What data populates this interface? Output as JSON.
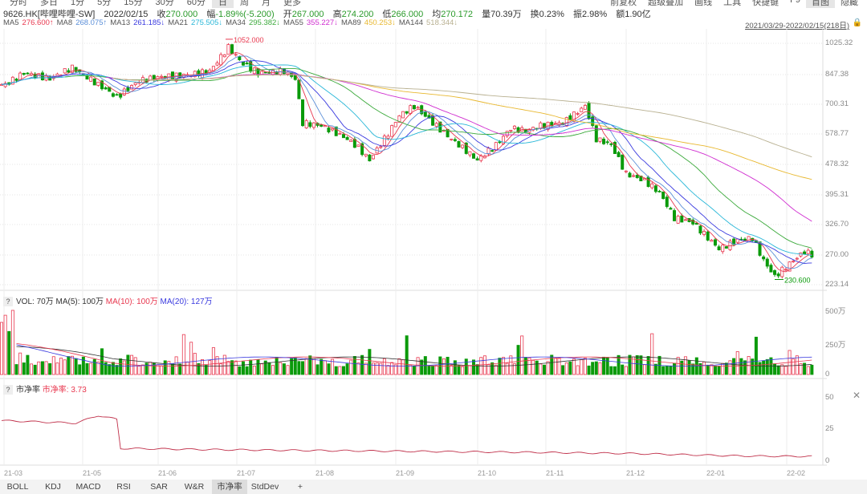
{
  "top_tabs": [
    "分时",
    "多日",
    "1分",
    "5分",
    "15分",
    "30分",
    "60分",
    "日",
    "周",
    "月",
    "更多"
  ],
  "top_tabs_selected": "日",
  "top_right": [
    "前复权",
    "超级叠加",
    "画线",
    "工具",
    "快捷键",
    "F9",
    "首图",
    "隐藏"
  ],
  "top_right_selected": "首图",
  "info": {
    "security": "9626.HK[哔哩哔哩-SW]",
    "date": "2022/02/15",
    "close_label": "收",
    "close": "270.000",
    "chg_label": "幅",
    "chg": "-1.89%(-5.200)",
    "open_label": "开",
    "open": "267.000",
    "high_label": "高",
    "high": "274.200",
    "low_label": "低",
    "low": "266.000",
    "avg_label": "均",
    "avg": "270.172",
    "vol_label": "量",
    "vol": "70.39万",
    "turn_label": "换",
    "turn": "0.23%",
    "amp_label": "振",
    "amp": "2.98%",
    "amt_label": "额",
    "amt": "1.90亿"
  },
  "ma_legend": [
    {
      "label": "MA5",
      "value": "276.600↑",
      "color": "#e8384f"
    },
    {
      "label": "MA8",
      "value": "268.075↑",
      "color": "#5b8fd8"
    },
    {
      "label": "MA13",
      "value": "261.185↓",
      "color": "#3a3adf"
    },
    {
      "label": "MA21",
      "value": "275.505↓",
      "color": "#29b7d8"
    },
    {
      "label": "MA34",
      "value": "295.382↓",
      "color": "#3caa3c"
    },
    {
      "label": "MA55",
      "value": "355.227↓",
      "color": "#d02ed0"
    },
    {
      "label": "MA89",
      "value": "450.253↓",
      "color": "#e8b830"
    },
    {
      "label": "MA144",
      "value": "518.344↓",
      "color": "#b8b090"
    }
  ],
  "date_range": "2021/03/29-2022/02/15(218日)",
  "price_axis": [
    "1025.32",
    "847.38",
    "700.31",
    "578.77",
    "478.32",
    "395.31",
    "326.70",
    "270.00",
    "223.14"
  ],
  "annotations": {
    "high": "1052.000",
    "low": "230.600"
  },
  "vol_header": {
    "q": "?",
    "vol": "VOL: 70万",
    "ma5": "MA(5): 100万",
    "ma10": "MA(10): 100万",
    "ma20": "MA(20): 127万"
  },
  "vol_axis": [
    "500万",
    "250万",
    "0"
  ],
  "pb_header": {
    "q": "?",
    "name": "市净率",
    "value": "市净率: 3.73"
  },
  "pb_axis": [
    "50",
    "25",
    "0"
  ],
  "bottom_tabs": [
    "BOLL",
    "KDJ",
    "MACD",
    "RSI",
    "SAR",
    "W&R",
    "市净率",
    "StdDev",
    "+"
  ],
  "bottom_selected": "市净率",
  "colors": {
    "up": "#e8384f",
    "down": "#0a9a0a"
  },
  "chart_data": {
    "type": "candlestick",
    "title": "9626.HK 哔哩哔哩-SW 日K",
    "x_range": [
      "2021/03/29",
      "2022/02/15"
    ],
    "x_tick_labels": [
      "21-03",
      "21-05",
      "21-06",
      "21-07",
      "21-08",
      "21-09",
      "21-10",
      "21-11",
      "21-12",
      "22-01",
      "22-02"
    ],
    "y_scale": "log",
    "ylim": [
      223.14,
      1025.32
    ],
    "approx_close_by_day_index": [
      [
        1,
        790
      ],
      [
        6,
        850
      ],
      [
        13,
        820
      ],
      [
        19,
        880
      ],
      [
        26,
        790
      ],
      [
        31,
        730
      ],
      [
        37,
        810
      ],
      [
        43,
        830
      ],
      [
        50,
        840
      ],
      [
        56,
        860
      ],
      [
        61,
        1000
      ],
      [
        65,
        900
      ],
      [
        69,
        850
      ],
      [
        76,
        860
      ],
      [
        79,
        820
      ],
      [
        81,
        620
      ],
      [
        86,
        610
      ],
      [
        93,
        560
      ],
      [
        96,
        530
      ],
      [
        99,
        490
      ],
      [
        104,
        580
      ],
      [
        107,
        650
      ],
      [
        111,
        690
      ],
      [
        116,
        620
      ],
      [
        121,
        560
      ],
      [
        125,
        520
      ],
      [
        128,
        490
      ],
      [
        133,
        540
      ],
      [
        137,
        600
      ],
      [
        141,
        590
      ],
      [
        145,
        610
      ],
      [
        151,
        620
      ],
      [
        157,
        690
      ],
      [
        160,
        560
      ],
      [
        164,
        540
      ],
      [
        168,
        450
      ],
      [
        173,
        430
      ],
      [
        177,
        400
      ],
      [
        181,
        340
      ],
      [
        186,
        330
      ],
      [
        190,
        300
      ],
      [
        193,
        280
      ],
      [
        198,
        295
      ],
      [
        202,
        300
      ],
      [
        205,
        260
      ],
      [
        208,
        235
      ],
      [
        212,
        255
      ],
      [
        216,
        275
      ],
      [
        218,
        270
      ]
    ],
    "pb_ratio_approx": [
      [
        0,
        32
      ],
      [
        20,
        30
      ],
      [
        26,
        36
      ],
      [
        31,
        33
      ],
      [
        32,
        10
      ],
      [
        60,
        9
      ],
      [
        100,
        8
      ],
      [
        140,
        7
      ],
      [
        170,
        6
      ],
      [
        200,
        4
      ],
      [
        218,
        3.73
      ]
    ]
  }
}
